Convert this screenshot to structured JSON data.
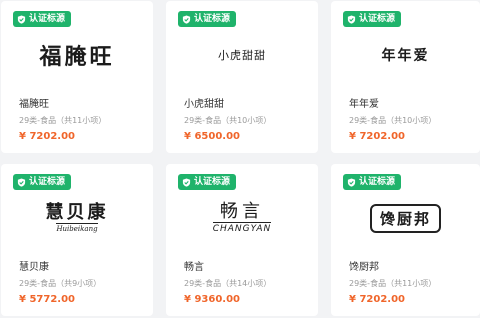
{
  "badge_label": "认证标源",
  "accent": "#1fb36b",
  "price_color": "#f0652a",
  "cards": [
    {
      "logo_main": "福腌旺",
      "name": "福腌旺",
      "meta": "29类-食品（共11小项）",
      "price": "¥ 7202.00"
    },
    {
      "logo_main": "小虎甜甜",
      "name": "小虎甜甜",
      "meta": "29类-食品（共10小项）",
      "price": "¥ 6500.00"
    },
    {
      "logo_main": "年年爱",
      "name": "年年爱",
      "meta": "29类-食品（共10小项）",
      "price": "¥ 7202.00"
    },
    {
      "logo_main": "慧贝康",
      "logo_sub": "Huibeikang",
      "name": "慧贝康",
      "meta": "29类-食品（共9小项）",
      "price": "¥ 5772.00"
    },
    {
      "logo_main": "畅言",
      "logo_sub": "CHANGYAN",
      "name": "畅言",
      "meta": "29类-食品（共14小项）",
      "price": "¥ 9360.00"
    },
    {
      "logo_main": "馋厨邦",
      "name": "馋厨邦",
      "meta": "29类-食品（共11小项）",
      "price": "¥ 7202.00"
    }
  ]
}
